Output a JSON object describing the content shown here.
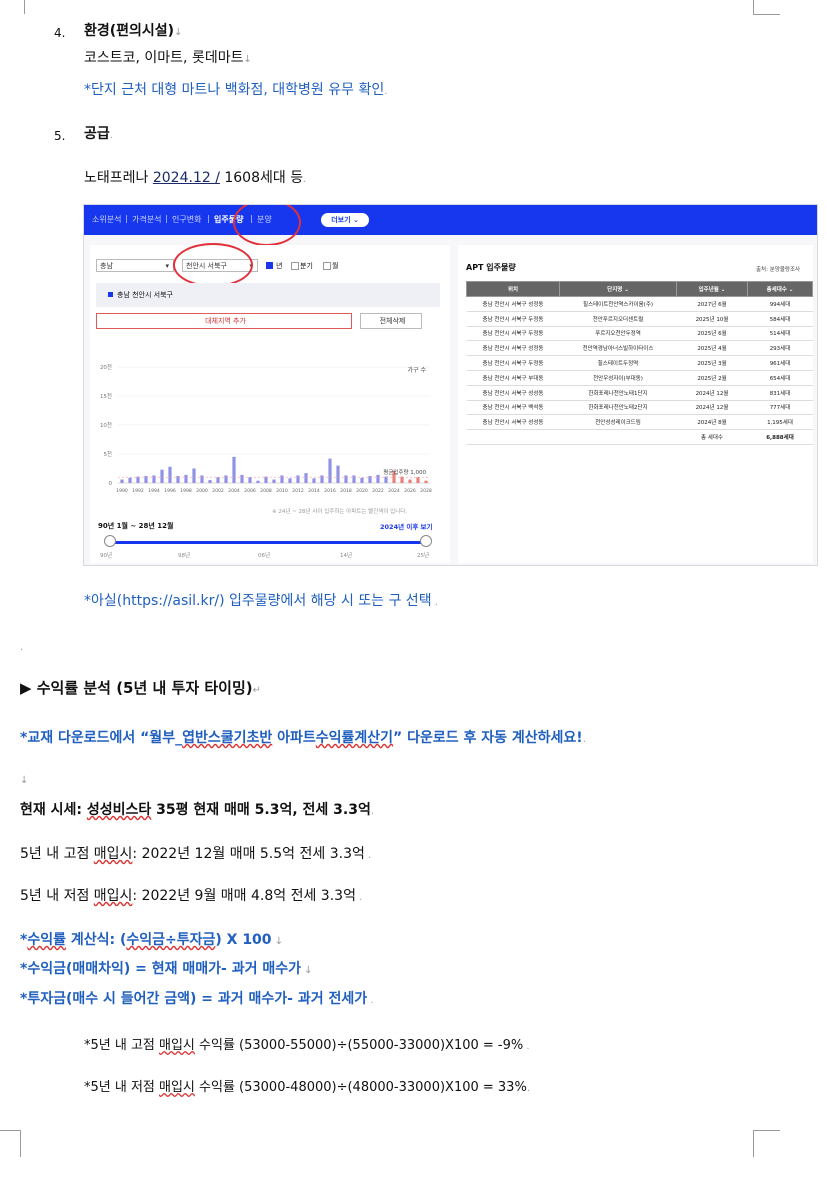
{
  "section4": {
    "number": "4.",
    "heading": "환경(편의시설)",
    "body": "코스트코, 이마트, 롯데마트",
    "note": "*단지 근처 대형 마트나 백화점, 대학병원 유무 확인"
  },
  "section5": {
    "number": "5.",
    "heading": "공급",
    "body_prefix": "노태프레나 ",
    "body_date": "2024.12 /",
    "body_suffix": " 1608세대 등"
  },
  "screenshot": {
    "nav_items": [
      "소위분석",
      "|",
      "가격분석",
      "|",
      "인구변화",
      "|",
      "입주물량",
      "|",
      "분양"
    ],
    "nav_more": "더보기 ⌄",
    "filter_province": "충남",
    "filter_city": "천안시 서북구",
    "filter_year": "년",
    "filter_quarter": "분기",
    "filter_month": "월",
    "selected_region": "충남 천안시 서북구",
    "add_region_button": "대체지역 추가",
    "clear_button": "전체삭제",
    "chart_legend": "가구 수",
    "chart_note": "※ 24년 ~ 28년 사이 입주하는 아파트는 빨간색이 입니다.",
    "period_label": "90년 1월 ~ 28년 12월",
    "period_link": "2024년 이후 보기",
    "slider_ticks": [
      "90년",
      "98년",
      "06년",
      "14년",
      "25년"
    ],
    "avg_label": "평균입주량 1,000",
    "table_title": "APT 입주물량",
    "table_source": "출처: 분양물량조사",
    "table_headers": [
      "위치",
      "단지명 ⌄",
      "입주년월 ⌄",
      "총세대수 ⌄"
    ],
    "table_rows": [
      [
        "충남 천안시 서북구 성정동",
        "힐스테이트천안역스카이움(주)",
        "2027년 6월",
        "994세대"
      ],
      [
        "충남 천안시 서북구 두정동",
        "천안푸르지오더센트럴",
        "2025년 10월",
        "584세대"
      ],
      [
        "충남 천안시 서북구 두정동",
        "푸르지오천안두정역",
        "2025년 6월",
        "514세대"
      ],
      [
        "충남 천안시 서북구 성정동",
        "천안역경남아너스빌하이타이스",
        "2025년 4월",
        "293세대"
      ],
      [
        "충남 천안시 서북구 두정동",
        "힐스테이트두정역",
        "2025년 3월",
        "961세대"
      ],
      [
        "충남 천안시 서북구 부대동",
        "천안우성자이(부대동)",
        "2025년 2월",
        "654세대"
      ],
      [
        "충남 천안시 서북구 성성동",
        "한화포레나천안노태1단지",
        "2024년 12월",
        "831세대"
      ],
      [
        "충남 천안시 서북구 백석동",
        "한화포레나천안노태2단지",
        "2024년 12월",
        "777세대"
      ],
      [
        "충남 천안시 서북구 성성동",
        "천안성성레이크드림",
        "2024년 8월",
        "1,195세대"
      ]
    ],
    "table_total_label": "총 세대수",
    "table_total_value": "6,888세대"
  },
  "chart_data": {
    "type": "bar",
    "categories": [
      "1990",
      "1991",
      "1992",
      "1993",
      "1994",
      "1995",
      "1996",
      "1997",
      "1998",
      "1999",
      "2000",
      "2001",
      "2002",
      "2003",
      "2004",
      "2005",
      "2006",
      "2007",
      "2008",
      "2009",
      "2010",
      "2011",
      "2012",
      "2013",
      "2014",
      "2015",
      "2016",
      "2017",
      "2018",
      "2019",
      "2020",
      "2021",
      "2022",
      "2023",
      "2024",
      "2025",
      "2026",
      "2027",
      "2028"
    ],
    "values": [
      600,
      900,
      1100,
      1200,
      1300,
      2300,
      2800,
      1200,
      1400,
      2500,
      1300,
      500,
      1000,
      1300,
      4500,
      1400,
      1000,
      400,
      1100,
      600,
      1300,
      800,
      1300,
      1700,
      800,
      1300,
      4200,
      3000,
      1300,
      1300,
      900,
      1200,
      1400,
      1100,
      2100,
      1100,
      600,
      1000,
      400
    ],
    "highlight_from": "2024",
    "yticks": [
      "0",
      "5천",
      "10천",
      "15천",
      "20천"
    ],
    "ylim": [
      0,
      20000
    ],
    "xticks": [
      "1990",
      "1992",
      "1994",
      "1996",
      "1998",
      "2000",
      "2002",
      "2004",
      "2006",
      "2008",
      "2010",
      "2012",
      "2014",
      "2016",
      "2018",
      "2020",
      "2022",
      "2024",
      "2026",
      "2028"
    ],
    "legend": "가구 수",
    "bar_color": "#8f93e8",
    "highlight_color": "#e8827f",
    "avg_value": 1000
  },
  "source_note": "*아실(https://asil.kr/) 입주물량에서 해당 시 또는 구 선택",
  "profit": {
    "heading": "▶ 수익률 분석 (5년 내 투자 타이밍)",
    "download_prefix": "*교재 다운로드에서 “월부_",
    "download_sq": "엽반스쿨기초반",
    "download_mid": " 아파트",
    "download_sq2": "수익률계산기",
    "download_suffix": "” 다운로드 후 자동 계산하세요!",
    "arrow": "↓",
    "current_prefix": "현재 시세: ",
    "current_sq": "성성비스타",
    "current_suffix": " 35평 현재 매매 5.3억, 전세 3.3억",
    "high_prefix": "5년 내 고점 ",
    "high_sq": "매입시",
    "high_suffix": ": 2022년 12월 매매 5.5억 전세 3.3억",
    "low_prefix": "5년 내 저점 ",
    "low_sq": "매입시",
    "low_suffix": ": 2022년 9월 매매 4.8억 전세 3.3억",
    "formula1_prefix": "*",
    "formula1_sq": "수익률",
    "formula1_mid": " 계산식: (",
    "formula1_sq2": "수익금÷투자금",
    "formula1_suffix": ") X 100",
    "formula2": "*수익금(매매차익) = 현재 매매가- 과거 매수가",
    "formula3": "*투자금(매수 시 들어간 금액) = 과거 매수가- 과거 전세가",
    "calc1_prefix": "*5년 내 고점 ",
    "calc1_sq": "매입시",
    "calc1_suffix": " 수익률 (53000-55000)÷(55000-33000)X100 = -9%",
    "calc2_prefix": "*5년 내 저점 ",
    "calc2_sq": "매입시",
    "calc2_suffix": " 수익률 (53000-48000)÷(48000-33000)X100 = 33%"
  }
}
